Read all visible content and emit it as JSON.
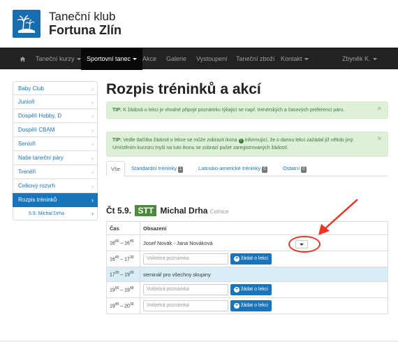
{
  "header": {
    "brand_line1": "Taneční klub",
    "brand_line2": "Fortuna Zlín",
    "logo_icon": "palm-island-logo"
  },
  "nav": {
    "home_icon": "home-icon",
    "items": [
      {
        "label": "Taneční kurzy",
        "dropdown": true
      },
      {
        "label": "Sportovní tanec",
        "dropdown": true,
        "active": true
      },
      {
        "label": "Akce"
      },
      {
        "label": "Galerie"
      },
      {
        "label": "Vystoupení"
      },
      {
        "label": "Taneční zboží"
      },
      {
        "label": "Kontakt",
        "dropdown": true
      }
    ],
    "user": "Zbyněk K."
  },
  "sidebar": {
    "items": [
      {
        "label": "Baby Club"
      },
      {
        "label": "Junioři"
      },
      {
        "label": "Dospělí Hobby, D"
      },
      {
        "label": "Dospělí CBAM"
      },
      {
        "label": "Senioři"
      },
      {
        "label": "Naše taneční páry"
      },
      {
        "label": "Trenéři"
      },
      {
        "label": "Celkový rozvrh"
      },
      {
        "label": "Rozpis tréninků",
        "active": true
      },
      {
        "label": "5.9. Michal Drha",
        "sub": true
      }
    ]
  },
  "main": {
    "title": "Rozpis tréninků a akcí",
    "tip1": {
      "prefix": "TIP:",
      "text": "K žádosti o lekci je vhodné připojit poznámku týkající se např. trenérských a časových preferencí páru."
    },
    "tip2": {
      "prefix": "TIP:",
      "text_a": "Vedle tlačítka žádosti o lekce se může zobrazit ikona",
      "text_b": "informující, že o danou lekci zažádal již někdo jiný. Umístěním kurzoru myši na tuto ikonu se zobrazí počet zaregistrovaných žádostí."
    },
    "tabs": [
      {
        "label": "Vše",
        "active": true
      },
      {
        "label": "Standardní tréninky",
        "badge": "1"
      },
      {
        "label": "Latinsko-americké tréninky",
        "badge": "0"
      },
      {
        "label": "Ostatní",
        "badge": "0"
      }
    ],
    "session": {
      "day": "Čt 5.9.",
      "tag": "STT",
      "trainer": "Michal Drha",
      "venue": "Celnice"
    },
    "table": {
      "col_time": "Čas",
      "col_content": "Obsazení",
      "rows": [
        {
          "start_h": "16",
          "start_m": "00",
          "end_h": "16",
          "end_m": "45",
          "text": "Josef Novák - Jana Nováková"
        },
        {
          "start_h": "16",
          "start_m": "45",
          "end_h": "17",
          "end_m": "30",
          "placeholder": "Volitelná poznámka",
          "button": "žádat o lekci"
        },
        {
          "start_h": "17",
          "start_m": "30",
          "end_h": "19",
          "end_m": "00",
          "text": "seminář pro všechny skupiny"
        },
        {
          "start_h": "19",
          "start_m": "00",
          "end_h": "19",
          "end_m": "45",
          "placeholder": "Volitelná poznámka",
          "button": "žádat o lekci"
        },
        {
          "start_h": "19",
          "start_m": "45",
          "end_h": "20",
          "end_m": "30",
          "placeholder": "Volitelná poznámka",
          "button": "žádat o lekci"
        }
      ]
    }
  },
  "colors": {
    "accent": "#1a74ba",
    "navbar": "#222222",
    "tip_bg": "#dff0d8",
    "info_row": "#d9edf7",
    "stt_tag": "#4b8b3b",
    "annotation": "#ee3322"
  }
}
